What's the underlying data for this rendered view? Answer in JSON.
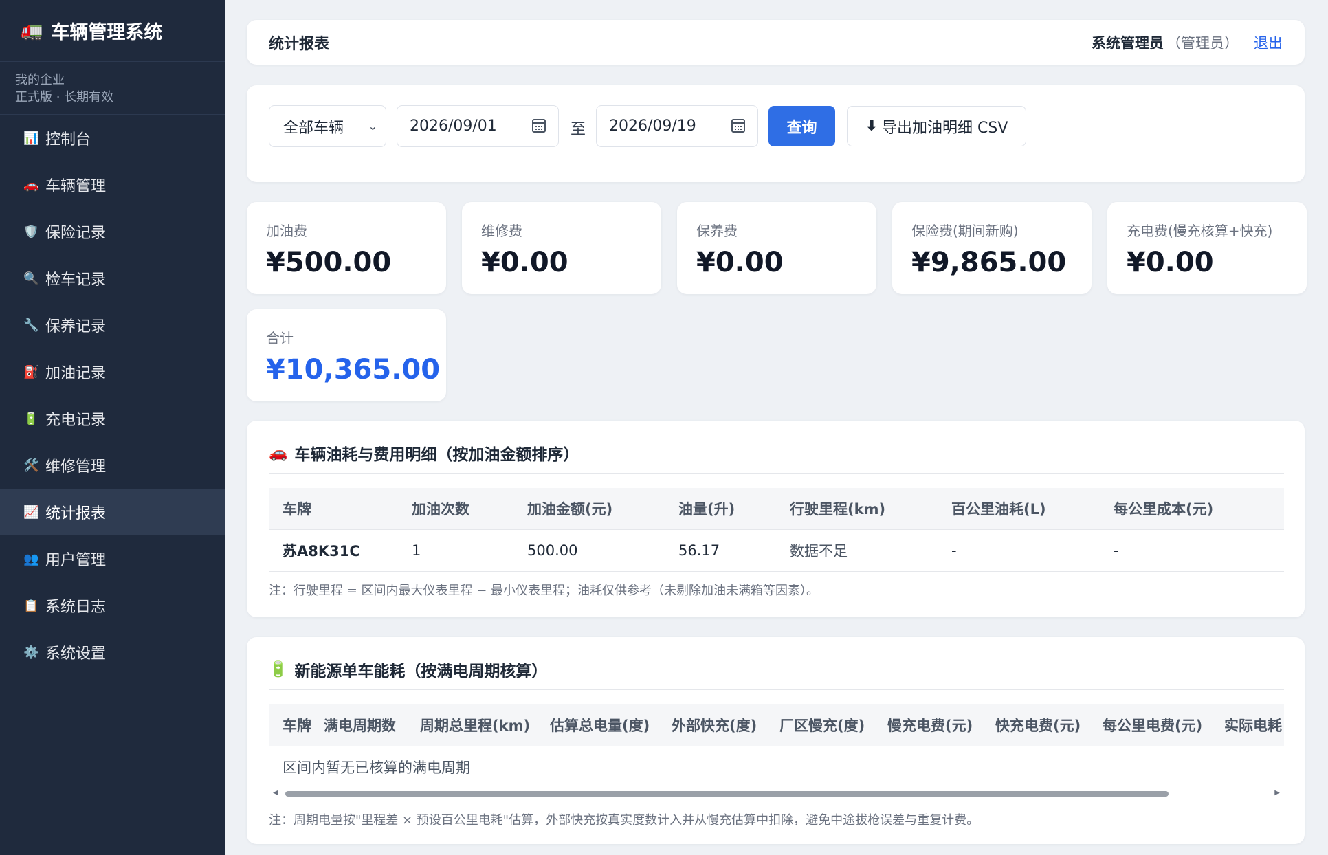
{
  "app": {
    "brand_icon": "🚛",
    "title": "车辆管理系统",
    "org_name": "我的企业",
    "org_plan": "正式版 · 长期有效"
  },
  "sidebar": {
    "items": [
      {
        "icon": "📊",
        "label": "控制台"
      },
      {
        "icon": "🚗",
        "label": "车辆管理"
      },
      {
        "icon": "🛡️",
        "label": "保险记录"
      },
      {
        "icon": "🔍",
        "label": "检车记录"
      },
      {
        "icon": "🔧",
        "label": "保养记录"
      },
      {
        "icon": "⛽",
        "label": "加油记录"
      },
      {
        "icon": "🔋",
        "label": "充电记录"
      },
      {
        "icon": "🛠️",
        "label": "维修管理"
      },
      {
        "icon": "📈",
        "label": "统计报表"
      },
      {
        "icon": "👥",
        "label": "用户管理"
      },
      {
        "icon": "📋",
        "label": "系统日志"
      },
      {
        "icon": "⚙️",
        "label": "系统设置"
      }
    ],
    "active_index": 8
  },
  "header": {
    "page_title": "统计报表",
    "user_name": "系统管理员",
    "user_role": "（管理员）",
    "logout": "退出"
  },
  "filter": {
    "vehicle_select": "全部车辆",
    "start_date": "2026/09/01",
    "to_label": "至",
    "end_date": "2026/09/19",
    "query_button": "查询",
    "export_icon": "⬇",
    "export_button": "导出加油明细 CSV"
  },
  "stats": [
    {
      "label": "加油费",
      "value": "¥500.00"
    },
    {
      "label": "维修费",
      "value": "¥0.00"
    },
    {
      "label": "保养费",
      "value": "¥0.00"
    },
    {
      "label": "保险费(期间新购)",
      "value": "¥9,865.00"
    },
    {
      "label": "充电费(慢充核算+快充)",
      "value": "¥0.00"
    }
  ],
  "total": {
    "label": "合计",
    "value": "¥10,365.00"
  },
  "fuel_section": {
    "icon": "🚗",
    "title": "车辆油耗与费用明细（按加油金额排序）",
    "columns": [
      "车牌",
      "加油次数",
      "加油金额(元)",
      "油量(升)",
      "行驶里程(km)",
      "百公里油耗(L)",
      "每公里成本(元)"
    ],
    "rows": [
      [
        "苏A8K31C",
        "1",
        "500.00",
        "56.17",
        "数据不足",
        "-",
        "-"
      ]
    ],
    "note": "注：行驶里程 = 区间内最大仪表里程 − 最小仪表里程；油耗仅供参考（未剔除加油未满箱等因素）。"
  },
  "ev_section": {
    "icon": "🔋",
    "title": "新能源单车能耗（按满电周期核算）",
    "columns": [
      "车牌",
      "满电周期数",
      "周期总里程(km)",
      "估算总电量(度)",
      "外部快充(度)",
      "厂区慢充(度)",
      "慢充电费(元)",
      "快充电费(元)",
      "每公里电费(元)",
      "实际电耗"
    ],
    "empty_text": "区间内暂无已核算的满电周期",
    "note": "注：周期电量按\"里程差 × 预设百公里电耗\"估算，外部快充按真实度数计入并从慢充估算中扣除，避免中途拔枪误差与重复计费。"
  }
}
